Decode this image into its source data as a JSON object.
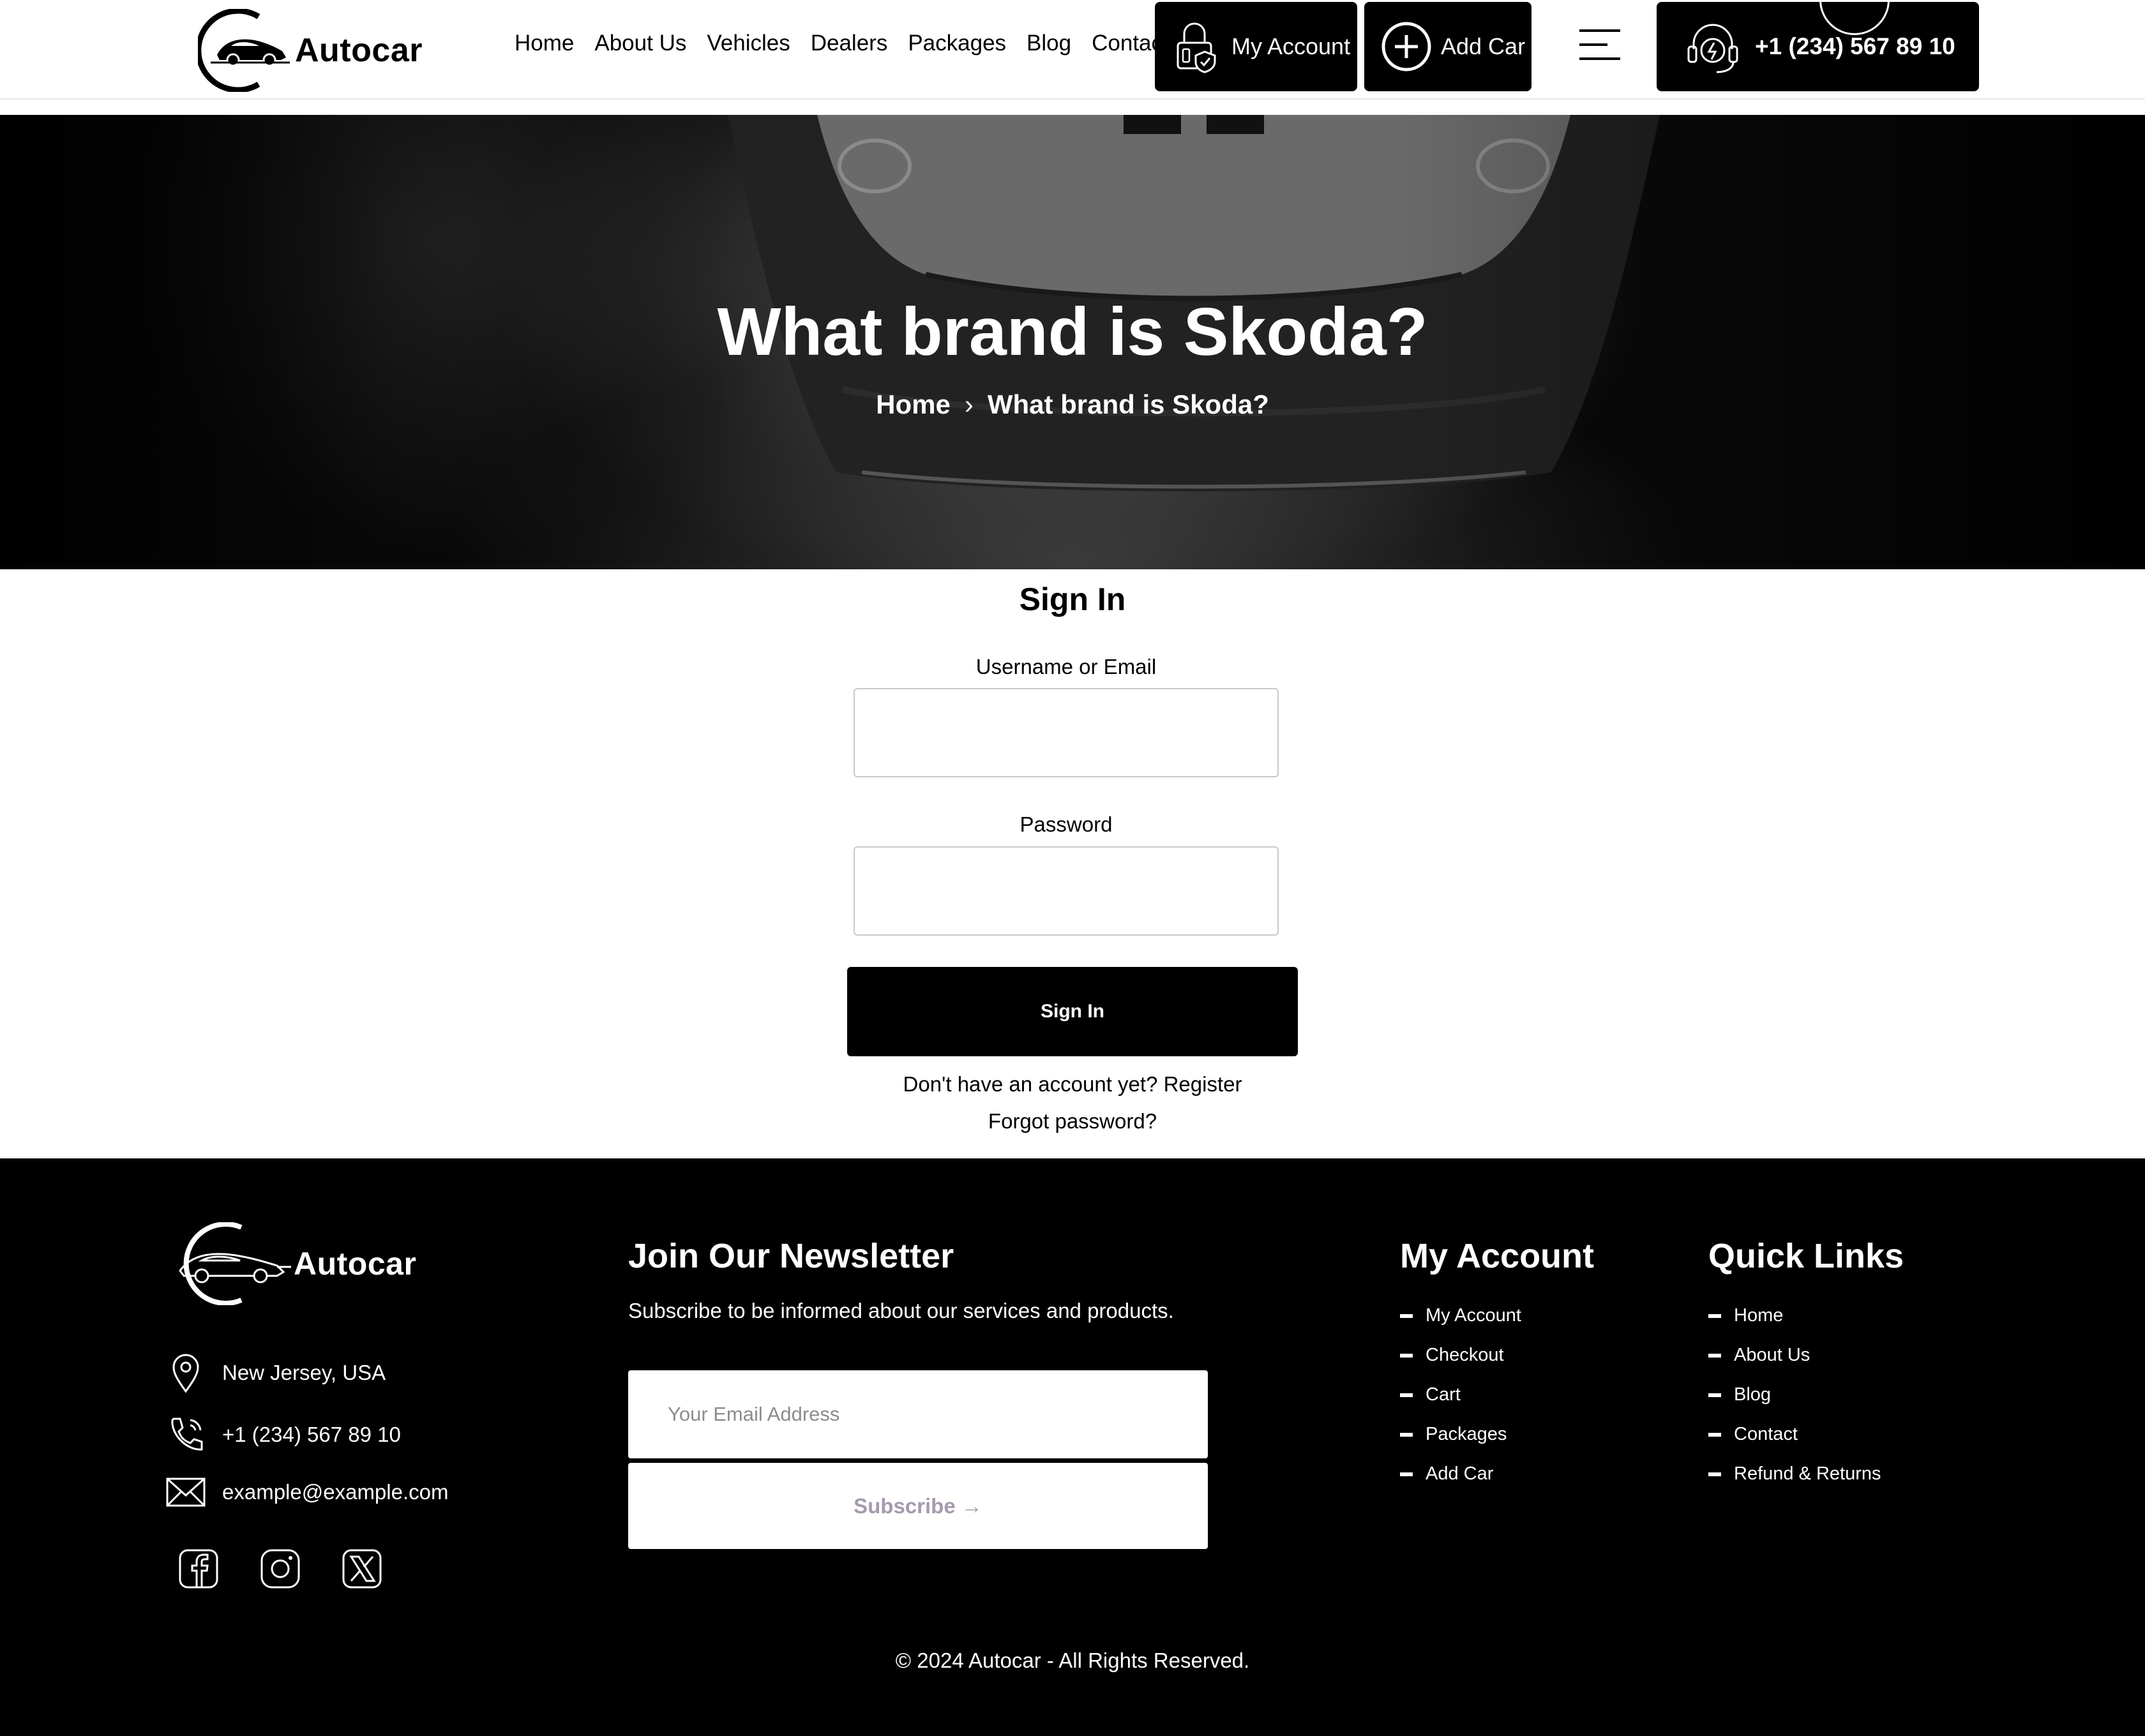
{
  "header": {
    "logo_text": "Autocar",
    "nav": [
      "Home",
      "About Us",
      "Vehicles",
      "Dealers",
      "Packages",
      "Blog",
      "Contact"
    ],
    "account_label": "My Account",
    "add_car_label": "Add Car",
    "phone": "+1 (234) 567 89 10"
  },
  "hero": {
    "title": "What brand is Skoda?",
    "breadcrumb_home": "Home",
    "breadcrumb_sep": "›",
    "breadcrumb_current": "What brand is Skoda?"
  },
  "signin": {
    "title": "Sign In",
    "username_label": "Username or Email",
    "username_value": "",
    "password_label": "Password",
    "password_value": "",
    "button_label": "Sign In",
    "register_prefix": "Don't have an account yet? ",
    "register_link": "Register",
    "forgot_link": "Forgot password?"
  },
  "footer": {
    "logo_text": "Autocar",
    "address": "New Jersey, USA",
    "phone": "+1 (234) 567 89 10",
    "email": "example@example.com",
    "newsletter_title": "Join Our Newsletter",
    "newsletter_sub": "Subscribe to be informed about our services and products.",
    "newsletter_placeholder": "Your Email Address",
    "subscribe_label": "Subscribe →",
    "account_title": "My Account",
    "account_links": [
      "My Account",
      "Checkout",
      "Cart",
      "Packages",
      "Add Car"
    ],
    "quick_title": "Quick Links",
    "quick_links": [
      "Home",
      "About Us",
      "Blog",
      "Contact",
      "Refund & Returns"
    ],
    "copyright": "© 2024 Autocar - All Rights Reserved."
  },
  "icons": {
    "account": "lock-shield-icon",
    "add_car": "plus-circle-icon",
    "phone": "headset-icon",
    "menu": "hamburger-icon",
    "address": "map-pin-icon",
    "footer_phone": "phone-icon",
    "email": "envelope-icon",
    "socials": [
      "facebook-icon",
      "instagram-icon",
      "x-icon"
    ]
  },
  "colors": {
    "primary": "#000000",
    "background": "#ffffff",
    "subscribe_text": "#a59aae"
  }
}
